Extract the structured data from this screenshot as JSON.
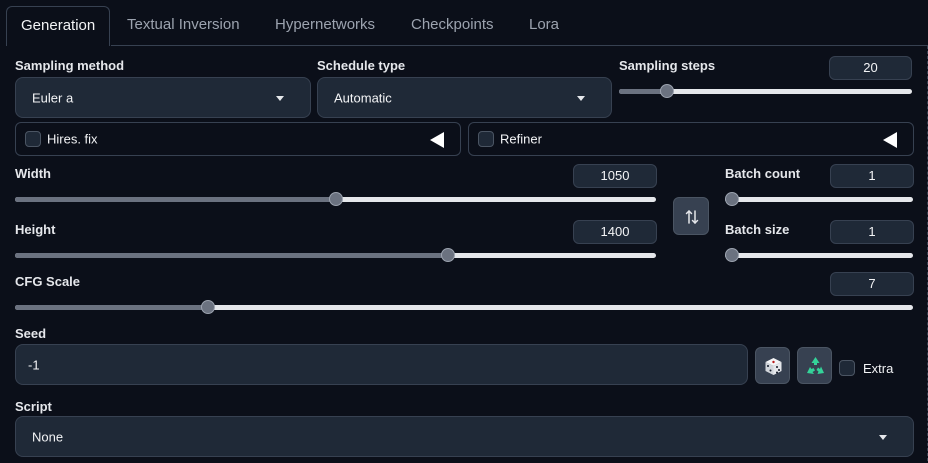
{
  "tabs": [
    {
      "label": "Generation"
    },
    {
      "label": "Textual Inversion"
    },
    {
      "label": "Hypernetworks"
    },
    {
      "label": "Checkpoints"
    },
    {
      "label": "Lora"
    }
  ],
  "sampling_method": {
    "label": "Sampling method",
    "value": "Euler a"
  },
  "schedule_type": {
    "label": "Schedule type",
    "value": "Automatic"
  },
  "sampling_steps": {
    "label": "Sampling steps",
    "value": "20",
    "slider_fraction": 0.146
  },
  "hires_fix": {
    "label": "Hires. fix",
    "checked": false
  },
  "refiner": {
    "label": "Refiner",
    "checked": false
  },
  "width": {
    "label": "Width",
    "value": "1050",
    "slider_fraction": 0.5
  },
  "height": {
    "label": "Height",
    "value": "1400",
    "slider_fraction": 0.68
  },
  "batch_count": {
    "label": "Batch count",
    "value": "1",
    "slider_fraction": 0.0
  },
  "batch_size": {
    "label": "Batch size",
    "value": "1",
    "slider_fraction": 0.0
  },
  "cfg_scale": {
    "label": "CFG Scale",
    "value": "7",
    "slider_fraction": 0.21
  },
  "seed": {
    "label": "Seed",
    "value": "-1",
    "extra_label": "Extra",
    "extra_checked": false
  },
  "script": {
    "label": "Script",
    "value": "None"
  },
  "icons": {
    "swap": "up-down-arrows-icon",
    "random": "dice-icon",
    "reuse": "recycle-icon"
  },
  "colors": {
    "background": "#0b0f19",
    "surface": "#1f2937",
    "border": "#374151",
    "slider_track": "#e5e7eb",
    "slider_fill": "#6b7280",
    "recycle_green": "#34d399"
  }
}
